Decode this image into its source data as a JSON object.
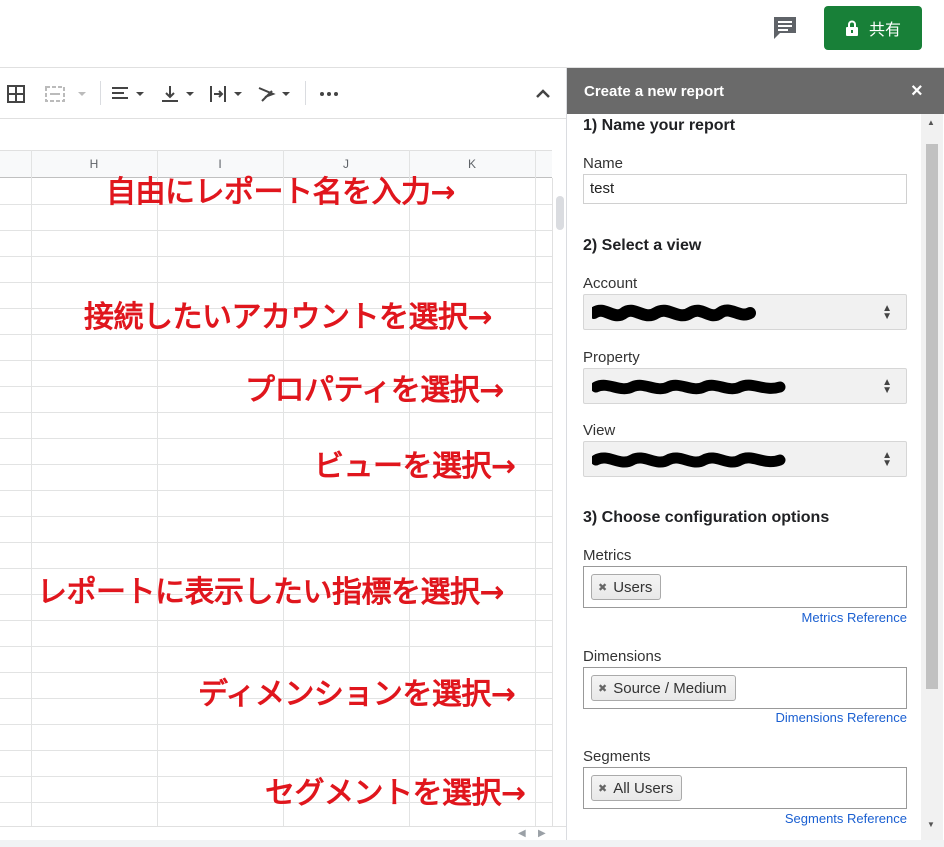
{
  "topbar": {
    "share_label": "共有"
  },
  "columns": [
    "H",
    "I",
    "J",
    "K"
  ],
  "annotations": {
    "name": "自由にレポート名を入力→",
    "account": "接続したいアカウントを選択→",
    "property": "プロパティを選択→",
    "view": "ビューを選択→",
    "metrics": "レポートに表示したい指標を選択→",
    "dimensions": "ディメンションを選択→",
    "segments": "セグメントを選択→"
  },
  "panel": {
    "title": "Create a new report",
    "close": "×",
    "step1": "1) Name your report",
    "name_label": "Name",
    "name_value": "test",
    "step2": "2) Select a view",
    "account_label": "Account",
    "property_label": "Property",
    "view_label": "View",
    "step3": "3) Choose configuration options",
    "metrics_label": "Metrics",
    "metrics_chip": "Users",
    "metrics_ref": "Metrics Reference",
    "dimensions_label": "Dimensions",
    "dimensions_chip": "Source / Medium",
    "dimensions_ref": "Dimensions Reference",
    "segments_label": "Segments",
    "segments_chip": "All Users",
    "segments_ref": "Segments Reference"
  },
  "colors": {
    "accent_green": "#188038",
    "annotation_red": "#e0161d",
    "link_blue": "#1a5fd1",
    "panel_header": "#6a6a6a"
  }
}
